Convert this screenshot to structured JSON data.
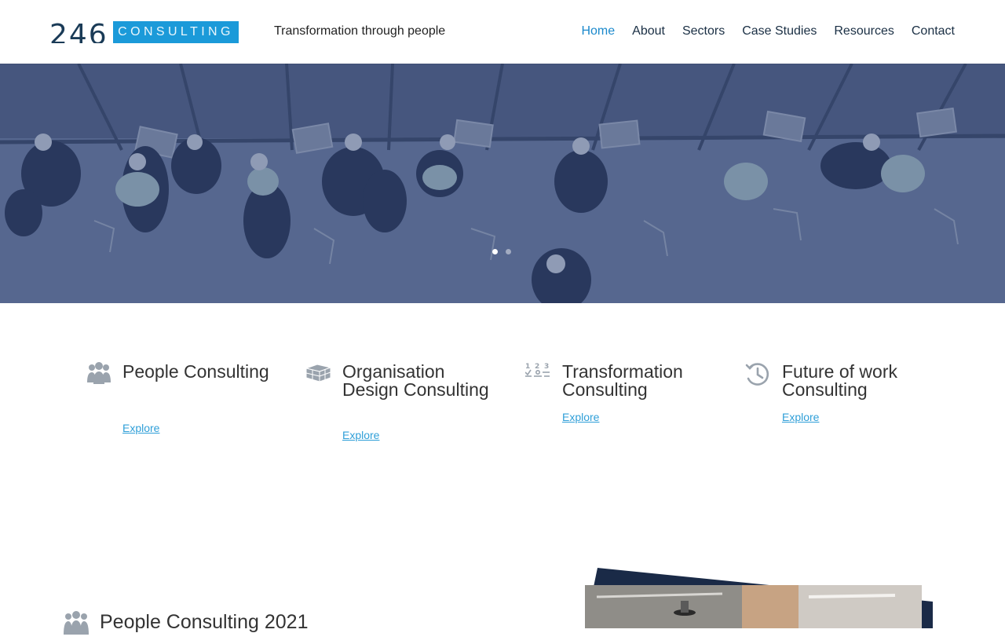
{
  "brand": {
    "logo_number": "246",
    "logo_word": "CONSULTING",
    "tagline": "Transformation through people"
  },
  "nav": {
    "items": [
      {
        "label": "Home",
        "active": true
      },
      {
        "label": "About"
      },
      {
        "label": "Sectors"
      },
      {
        "label": "Case Studies"
      },
      {
        "label": "Resources"
      },
      {
        "label": "Contact"
      }
    ]
  },
  "hero": {
    "slides": 2,
    "active_slide": 1
  },
  "services": [
    {
      "title": "People Consulting",
      "link": "Explore",
      "icon": "people-icon"
    },
    {
      "title": "Organisation Design Consulting",
      "link": "Explore",
      "icon": "blocks-icon"
    },
    {
      "title": "Transformation Consulting",
      "link": "Explore",
      "icon": "steps-icon"
    },
    {
      "title": "Future of work Consulting",
      "link": "Explore",
      "icon": "clock-history-icon"
    }
  ],
  "section": {
    "title": "People Consulting 2021",
    "icon": "people-icon"
  },
  "colors": {
    "accent": "#1b9ad9",
    "navy": "#1a3b57",
    "link": "#2f9fd8",
    "icon_gray": "#9aa3ad"
  }
}
